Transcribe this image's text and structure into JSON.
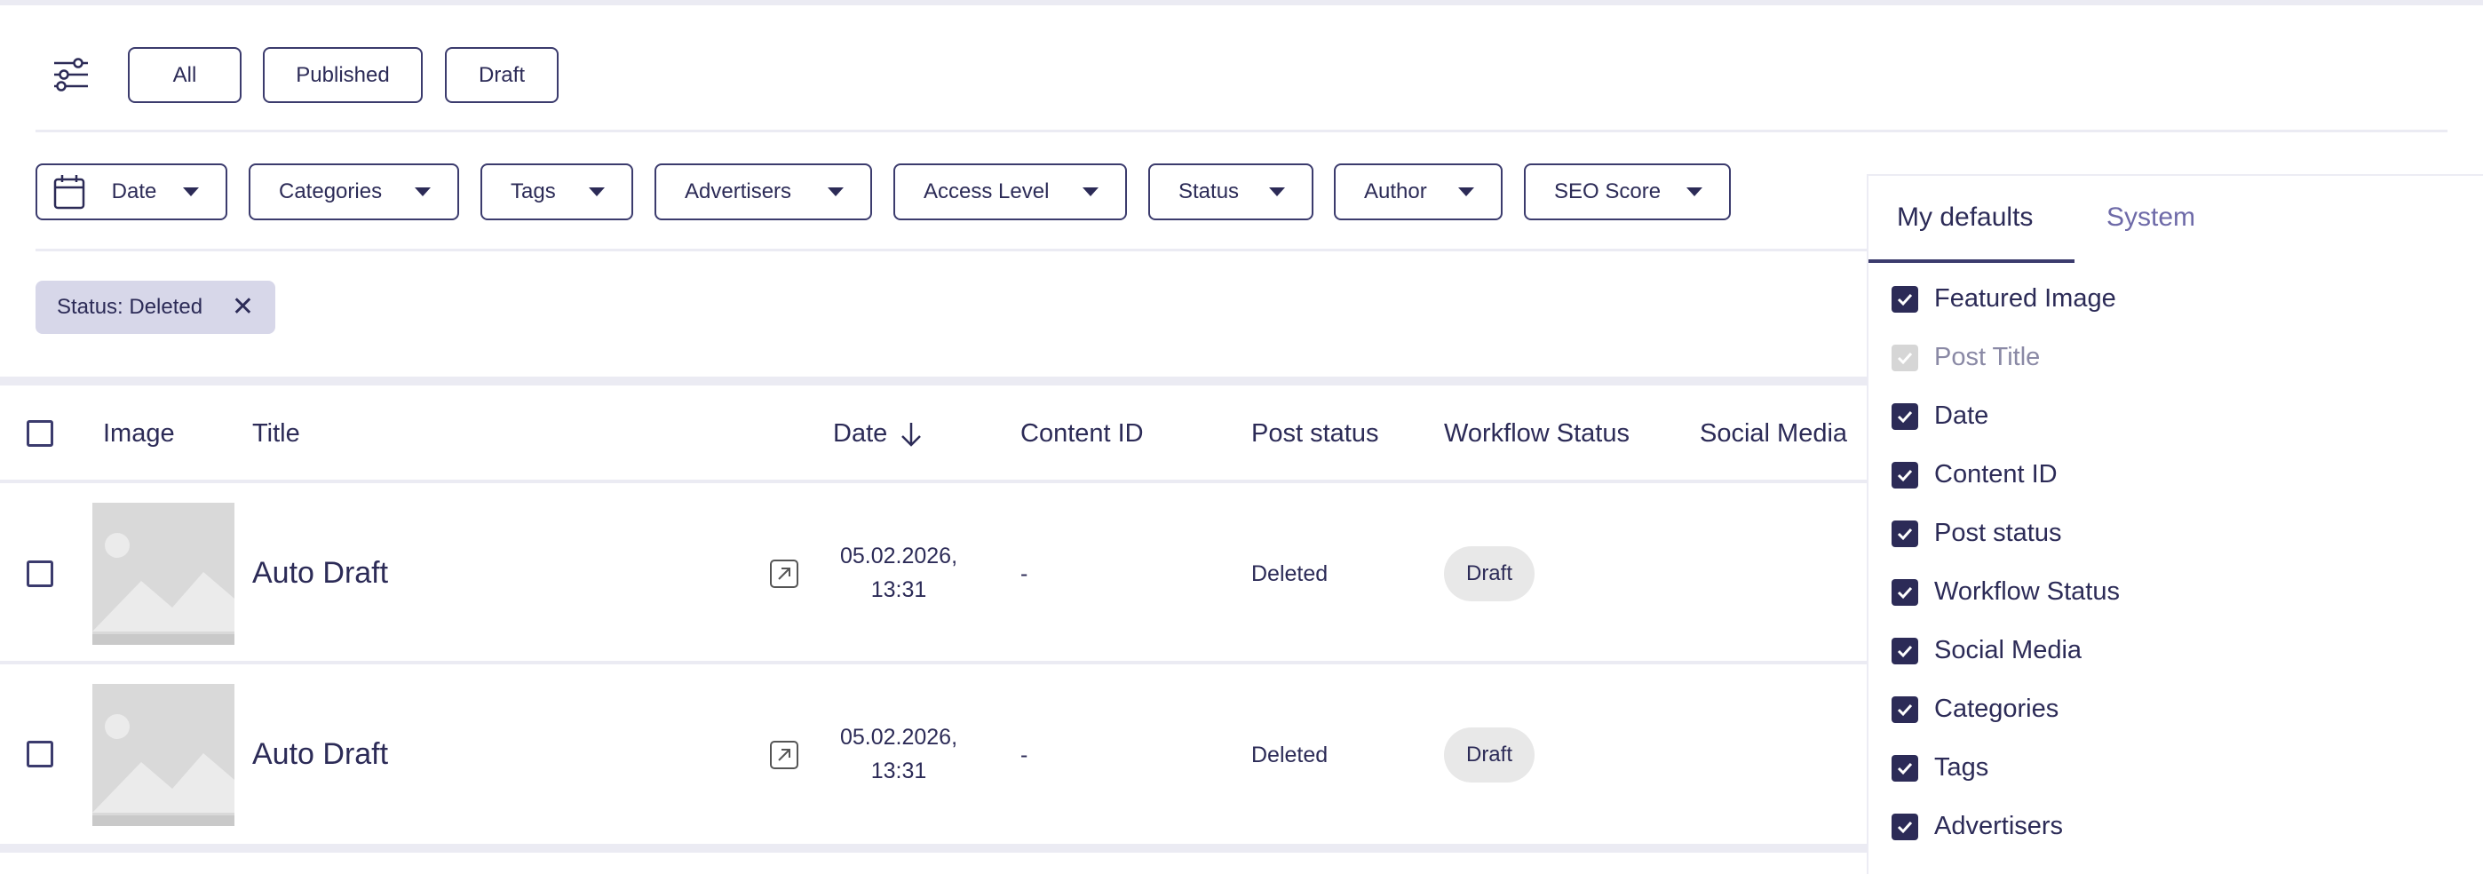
{
  "top_filters": {
    "all_label": "All",
    "published_label": "Published",
    "draft_label": "Draft"
  },
  "dropdowns": {
    "date": "Date",
    "categories": "Categories",
    "tags": "Tags",
    "advertisers": "Advertisers",
    "access_level": "Access Level",
    "status": "Status",
    "author": "Author",
    "seo_score": "SEO Score"
  },
  "active_filter_chip": "Status: Deleted",
  "table": {
    "headers": {
      "image": "Image",
      "title": "Title",
      "date": "Date",
      "content_id": "Content ID",
      "post_status": "Post status",
      "workflow_status": "Workflow Status",
      "social_media": "Social Media"
    },
    "rows": [
      {
        "title": "Auto Draft",
        "date_line1": "05.02.2026,",
        "date_line2": "13:31",
        "content_id": "-",
        "post_status": "Deleted",
        "workflow": "Draft"
      },
      {
        "title": "Auto Draft",
        "date_line1": "05.02.2026,",
        "date_line2": "13:31",
        "content_id": "-",
        "post_status": "Deleted",
        "workflow": "Draft"
      }
    ]
  },
  "column_panel": {
    "tabs": [
      "My defaults",
      "System"
    ],
    "active_tab": "My defaults",
    "options": [
      {
        "label": "Featured Image",
        "checked": true,
        "disabled": false
      },
      {
        "label": "Post Title",
        "checked": true,
        "disabled": true
      },
      {
        "label": "Date",
        "checked": true,
        "disabled": false
      },
      {
        "label": "Content ID",
        "checked": true,
        "disabled": false
      },
      {
        "label": "Post status",
        "checked": true,
        "disabled": false
      },
      {
        "label": "Workflow Status",
        "checked": true,
        "disabled": false
      },
      {
        "label": "Social Media",
        "checked": true,
        "disabled": false
      },
      {
        "label": "Categories",
        "checked": true,
        "disabled": false
      },
      {
        "label": "Tags",
        "checked": true,
        "disabled": false
      },
      {
        "label": "Advertisers",
        "checked": true,
        "disabled": false
      }
    ]
  },
  "colors": {
    "primary": "#2c2b57",
    "border": "#3b3b6d",
    "chip_bg": "#d7d7e9",
    "muted_tab": "#6e6aa8",
    "badge_bg": "#e8e8e8"
  }
}
